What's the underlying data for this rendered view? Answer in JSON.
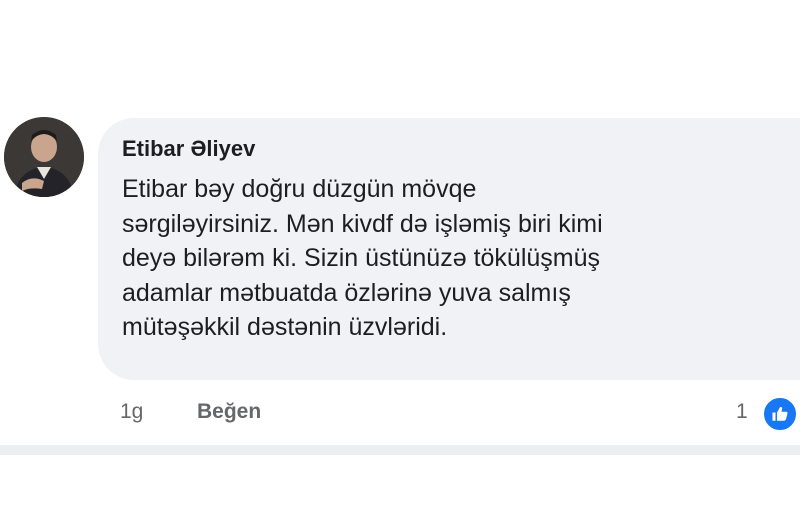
{
  "comment": {
    "author": "Etibar Əliyev",
    "text": "Etibar bəy doğru düzgün mövqe\nsərgiləyirsiniz. Mən kivdf də işləmiş biri kimi\ndeyə bilərəm ki. Sizin üstünüzə tökülüşmüş\nadamlar mətbuatda özlərinə yuva salmış\nmütəşəkkil dəstənin üzvləridi.",
    "time": "1g",
    "like_label": "Beğen",
    "reaction_count": "1",
    "reaction_icon": "thumbs-up-icon"
  },
  "colors": {
    "bubble_bg": "#f0f2f5",
    "text": "#1c1e21",
    "meta": "#65676b",
    "like_blue": "#1877f2"
  }
}
